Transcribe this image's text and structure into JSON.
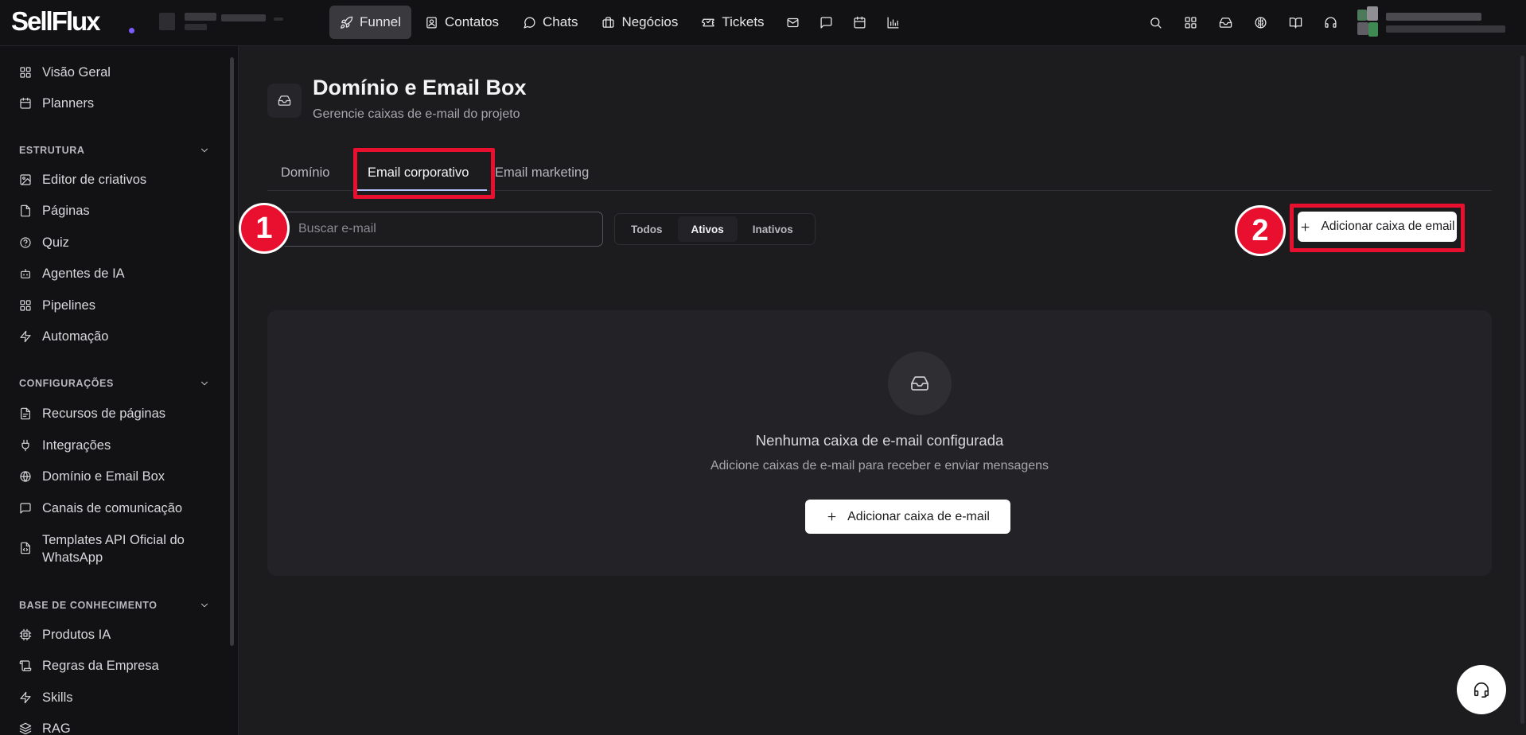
{
  "app": {
    "logo": "SellFlux",
    "brand_color": "#7c5cff",
    "highlight_color": "#e8102e"
  },
  "topnav": {
    "items": [
      {
        "label": "Funnel",
        "icon": "rocket-icon",
        "active": true
      },
      {
        "label": "Contatos",
        "icon": "contact-card-icon"
      },
      {
        "label": "Chats",
        "icon": "chat-bubble-icon"
      },
      {
        "label": "Negócios",
        "icon": "briefcase-icon"
      },
      {
        "label": "Tickets",
        "icon": "ticket-icon"
      }
    ],
    "icon_items": [
      "mail-icon",
      "message-square-icon",
      "calendar-icon",
      "bar-chart-icon"
    ],
    "right_icons": [
      "search-icon",
      "apps-grid-icon",
      "inbox-icon",
      "brain-icon",
      "book-open-icon",
      "headset-icon"
    ]
  },
  "sidebar": {
    "top_items": [
      {
        "label": "Visão Geral",
        "icon": "layout-grid-icon"
      },
      {
        "label": "Planners",
        "icon": "calendar-icon"
      }
    ],
    "sections": [
      {
        "title": "ESTRUTURA",
        "items": [
          {
            "label": "Editor de criativos",
            "icon": "image-edit-icon"
          },
          {
            "label": "Páginas",
            "icon": "file-icon"
          },
          {
            "label": "Quiz",
            "icon": "help-circle-icon"
          },
          {
            "label": "Agentes de IA",
            "icon": "bot-icon"
          },
          {
            "label": "Pipelines",
            "icon": "grid-icon"
          },
          {
            "label": "Automação",
            "icon": "zap-icon"
          }
        ]
      },
      {
        "title": "CONFIGURAÇÕES",
        "items": [
          {
            "label": "Recursos de páginas",
            "icon": "file-settings-icon"
          },
          {
            "label": "Integrações",
            "icon": "plug-icon"
          },
          {
            "label": "Domínio e Email Box",
            "icon": "globe-icon"
          },
          {
            "label": "Canais de comunicação",
            "icon": "message-square-icon"
          },
          {
            "label": "Templates API Oficial do",
            "label2": "WhatsApp",
            "icon": "file-code-icon"
          }
        ]
      },
      {
        "title": "BASE DE CONHECIMENTO",
        "items": [
          {
            "label": "Produtos IA",
            "icon": "cpu-icon"
          },
          {
            "label": "Regras da Empresa",
            "icon": "scroll-icon"
          },
          {
            "label": "Skills",
            "icon": "zap-icon"
          },
          {
            "label": "RAG",
            "icon": "layers-icon"
          }
        ]
      }
    ]
  },
  "page": {
    "title": "Domínio e Email Box",
    "subtitle": "Gerencie caixas de e-mail do projeto",
    "tabs": [
      "Domínio",
      "Email corporativo",
      "Email marketing"
    ],
    "active_tab": "Email corporativo",
    "search": {
      "placeholder": "Buscar e-mail",
      "value": ""
    },
    "filters": [
      "Todos",
      "Ativos",
      "Inativos"
    ],
    "active_filter": "Ativos",
    "add_button": "Adicionar caixa de email",
    "empty_state": {
      "title": "Nenhuma caixa de e-mail configurada",
      "subtitle": "Adicione caixas de e-mail para receber e enviar mensagens",
      "button": "Adicionar caixa de e-mail"
    },
    "markers": [
      "1",
      "2"
    ]
  }
}
